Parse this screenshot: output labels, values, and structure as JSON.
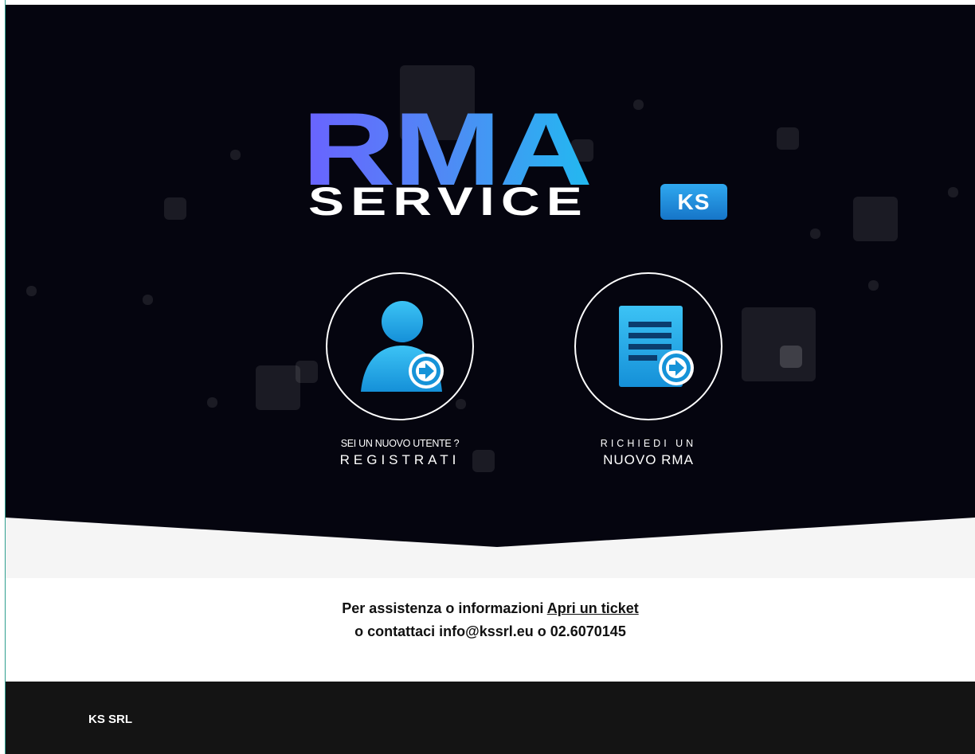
{
  "logo": {
    "title": "RMA",
    "subtitle": "SERVICE",
    "badge": "KS"
  },
  "actions": {
    "register": {
      "caption": "SEI UN NUOVO UTENTE ?",
      "label": "REGISTRATI",
      "icon": "user-arrow-icon"
    },
    "new_rma": {
      "caption": "RICHIEDI UN",
      "label": "NUOVO RMA",
      "icon": "document-arrow-icon"
    }
  },
  "support": {
    "line1_prefix": "Per assistenza o informazioni",
    "ticket_link": "Apri un ticket",
    "line2": "o contattaci info@kssrl.eu o 02.6070145"
  },
  "footer": {
    "company": "KS SRL"
  },
  "colors": {
    "hero_bg": "#05050f",
    "band": "#f5f5f5",
    "accent_gradient_start": "#6a62ff",
    "accent_gradient_end": "#22b9f0",
    "icon_blue": "#1fa8ea",
    "footer_bg": "#141414"
  }
}
